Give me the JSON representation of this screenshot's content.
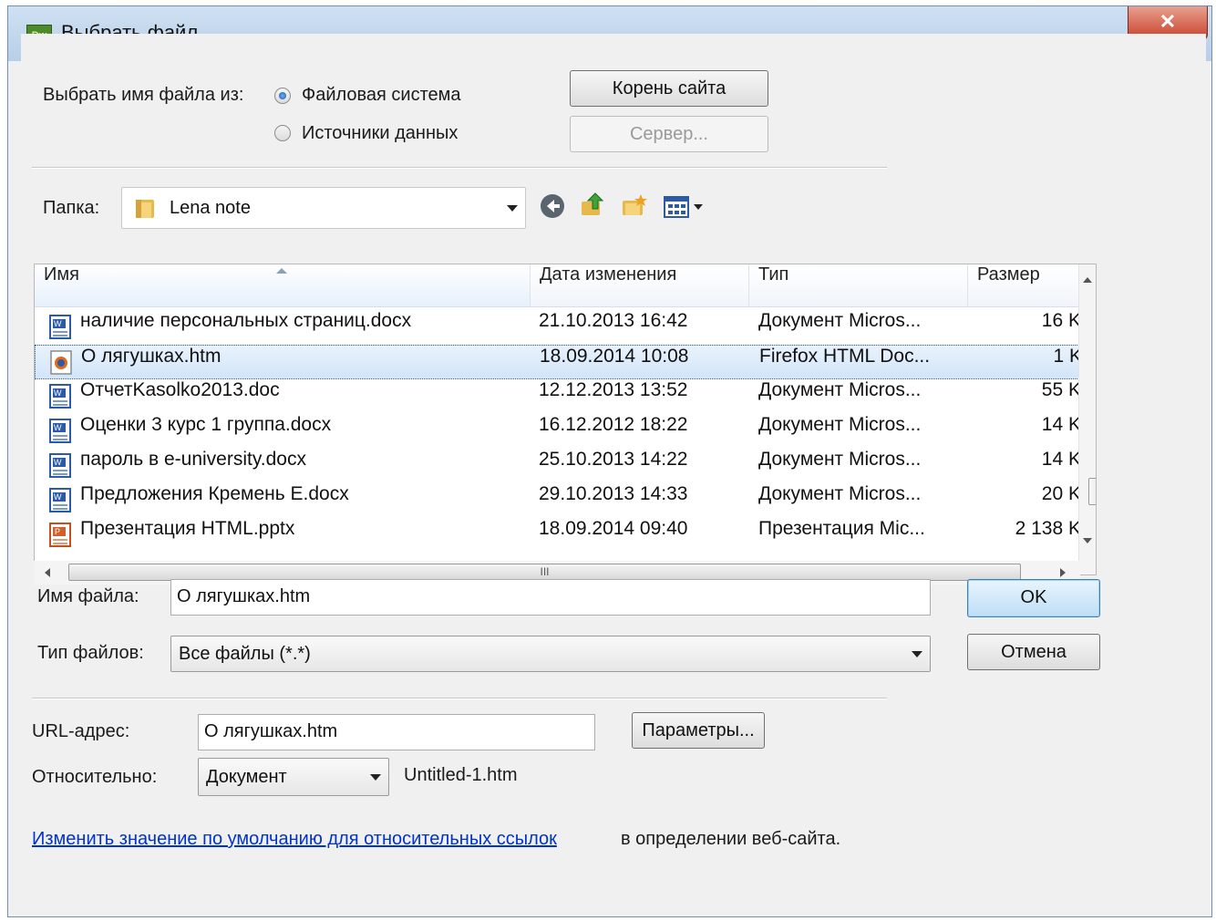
{
  "window": {
    "title": "Выбрать файл",
    "app_badge": "Dw",
    "close_glyph": "✕"
  },
  "source": {
    "label": "Выбрать имя файла из:",
    "option_filesystem": "Файловая система",
    "option_datasources": "Источники данных",
    "selected": "filesystem"
  },
  "buttons": {
    "site_root": "Корень сайта",
    "server": "Сервер...",
    "ok": "OK",
    "cancel": "Отмена",
    "params": "Параметры..."
  },
  "folder": {
    "label": "Папка:",
    "value": "Lena note"
  },
  "file_list": {
    "columns": [
      "Имя",
      "Дата изменения",
      "Тип",
      "Размер"
    ],
    "rows": [
      {
        "name": "наличие персональных страниц.docx",
        "date": "21.10.2013 16:42",
        "type": "Документ Micros...",
        "size": "16 K",
        "icon": "word-doc-icon"
      },
      {
        "name": "О лягушках.htm",
        "date": "18.09.2014 10:08",
        "type": "Firefox HTML Doc...",
        "size": "1 K",
        "icon": "firefox-html-icon",
        "selected": true
      },
      {
        "name": "ОтчетKasolko2013.doc",
        "date": "12.12.2013 13:52",
        "type": "Документ Micros...",
        "size": "55 K",
        "icon": "word-doc-icon"
      },
      {
        "name": "Оценки 3 курс 1 группа.docx",
        "date": "16.12.2012 18:22",
        "type": "Документ Micros...",
        "size": "14 K",
        "icon": "word-doc-icon"
      },
      {
        "name": "пароль в e-university.docx",
        "date": "25.10.2013 14:22",
        "type": "Документ Micros...",
        "size": "14 K",
        "icon": "word-doc-icon"
      },
      {
        "name": "Предложения Кремень Е.docx",
        "date": "29.10.2013 14:33",
        "type": "Документ Micros...",
        "size": "20 K",
        "icon": "word-doc-icon"
      },
      {
        "name": "Презентация HTML.pptx",
        "date": "18.09.2014 09:40",
        "type": "Презентация Mic...",
        "size": "2 138 K",
        "icon": "powerpoint-icon"
      }
    ],
    "hscroll_grip": "III"
  },
  "filename": {
    "label": "Имя файла:",
    "value": "О лягушках.htm"
  },
  "filetype": {
    "label": "Тип файлов:",
    "value": "Все файлы (*.*)"
  },
  "url": {
    "label": "URL-адрес:",
    "value": "О лягушках.htm"
  },
  "relative": {
    "label": "Относительно:",
    "value": "Документ",
    "file": "Untitled-1.htm"
  },
  "footer": {
    "link": "Изменить значение по умолчанию для относительных ссылок",
    "after": "в определении веб-сайта."
  },
  "colors": {
    "selection": "#d2e5fa",
    "link": "#0033cc",
    "accent": "#3c7fb1"
  }
}
